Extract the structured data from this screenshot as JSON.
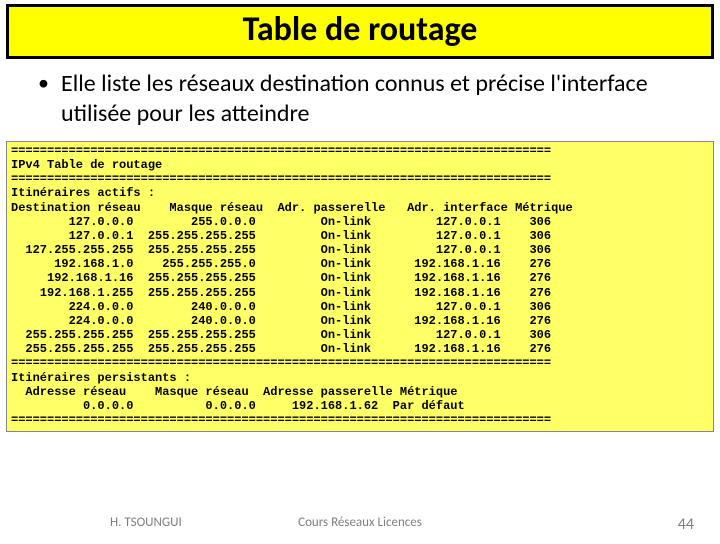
{
  "title": "Table de routage",
  "bullet": {
    "pre": "Elle liste les ",
    "emph1": "réseaux destination",
    "mid": " connus et précise l'",
    "emph2": "interface utilisée",
    "post": " pour les atteindre"
  },
  "terminal": {
    "sep": "===========================================================================",
    "header": "IPv4 Table de routage",
    "actifs": "Itinéraires actifs :",
    "cols": "Destination réseau    Masque réseau  Adr. passerelle   Adr. interface Métrique",
    "rows": [
      "        127.0.0.0        255.0.0.0         On-link         127.0.0.1    306",
      "        127.0.0.1  255.255.255.255         On-link         127.0.0.1    306",
      "  127.255.255.255  255.255.255.255         On-link         127.0.0.1    306",
      "      192.168.1.0    255.255.255.0         On-link      192.168.1.16    276",
      "     192.168.1.16  255.255.255.255         On-link      192.168.1.16    276",
      "    192.168.1.255  255.255.255.255         On-link      192.168.1.16    276",
      "        224.0.0.0        240.0.0.0         On-link         127.0.0.1    306",
      "        224.0.0.0        240.0.0.0         On-link      192.168.1.16    276",
      "  255.255.255.255  255.255.255.255         On-link         127.0.0.1    306",
      "  255.255.255.255  255.255.255.255         On-link      192.168.1.16    276"
    ],
    "persist": "Itinéraires persistants :",
    "pcols": "  Adresse réseau    Masque réseau  Adresse passerelle Métrique",
    "prow": "          0.0.0.0          0.0.0.0     192.168.1.62  Par défaut"
  },
  "footer": {
    "author": "H. TSOUNGUI",
    "course": "Cours Réseaux Licences",
    "page": "44"
  }
}
